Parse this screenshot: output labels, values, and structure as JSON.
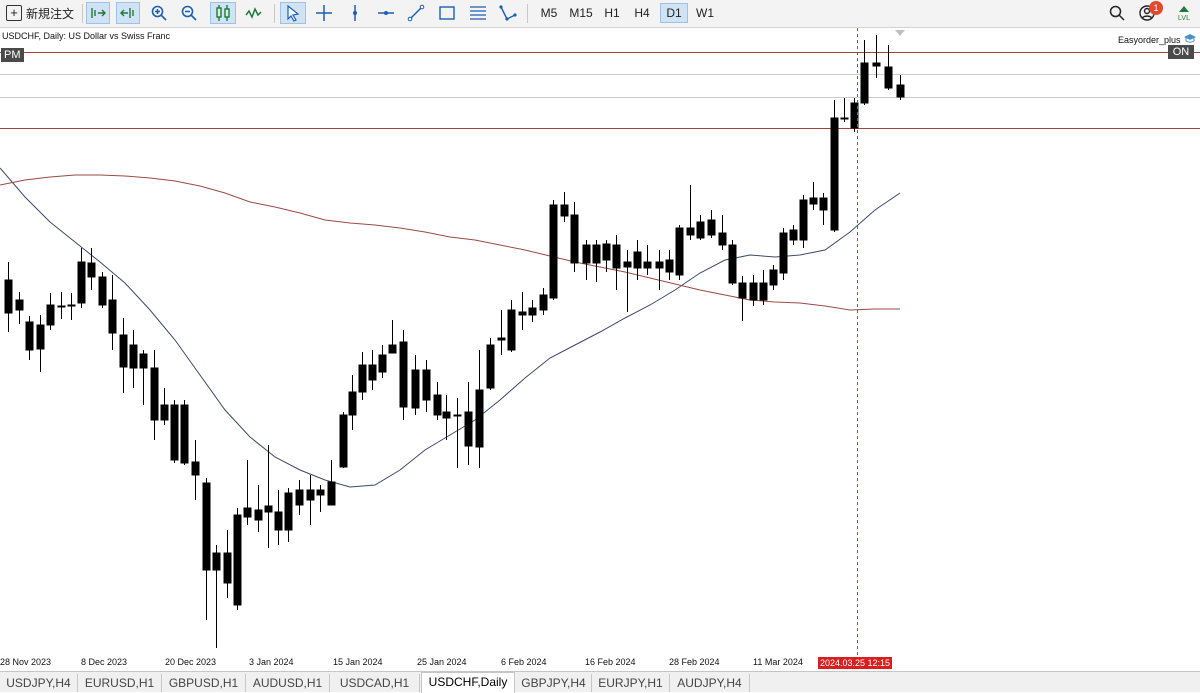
{
  "toolbar": {
    "new_order_label": "新規注文",
    "icons": [
      "depth-of-market-icon",
      "one-click-trading-icon",
      "zoom-in-icon",
      "zoom-out-icon",
      "candlestick-chart-icon",
      "line-chart-icon",
      "cursor-icon",
      "crosshair-icon",
      "vertical-line-icon",
      "horizontal-line-icon",
      "trend-line-icon",
      "rectangle-icon",
      "fibonacci-icon",
      "polyline-icon",
      "search-icon",
      "notifications-icon",
      "signal-icon"
    ],
    "timeframes": [
      "M5",
      "M15",
      "H1",
      "H4",
      "D1",
      "W1"
    ],
    "active_timeframe": "D1",
    "notification_count": "1",
    "signal_label": "LVL"
  },
  "chart": {
    "title": "USDCHF, Daily:  US Dollar vs Swiss Franc",
    "pm_label": "PM",
    "ea_label": "Easyorder_plus",
    "on_label": "ON",
    "cursor_date": "2024.03.25 12:15",
    "colors": {
      "candle_line": "#000000",
      "ma_fast": "#3c4a66",
      "ma_slow": "#9c4a44",
      "level_line": "#a0413c",
      "grid_line": "#cccccc",
      "cursor_line": "#b34a2b"
    }
  },
  "date_axis": [
    "28 Nov 2023",
    "8 Dec 2023",
    "20 Dec 2023",
    "3 Jan 2024",
    "15 Jan 2024",
    "25 Jan 2024",
    "6 Feb 2024",
    "16 Feb 2024",
    "28 Feb 2024",
    "11 Mar 2024"
  ],
  "tabs": [
    "USDJPY,H4",
    "EURUSD,H1",
    "GBPUSD,H1",
    "AUDUSD,H1",
    "USDCAD,H1",
    "USDCHF,Daily",
    "GBPJPY,H4",
    "EURJPY,H1",
    "AUDJPY,H4"
  ],
  "active_tab": "USDCHF,Daily"
}
